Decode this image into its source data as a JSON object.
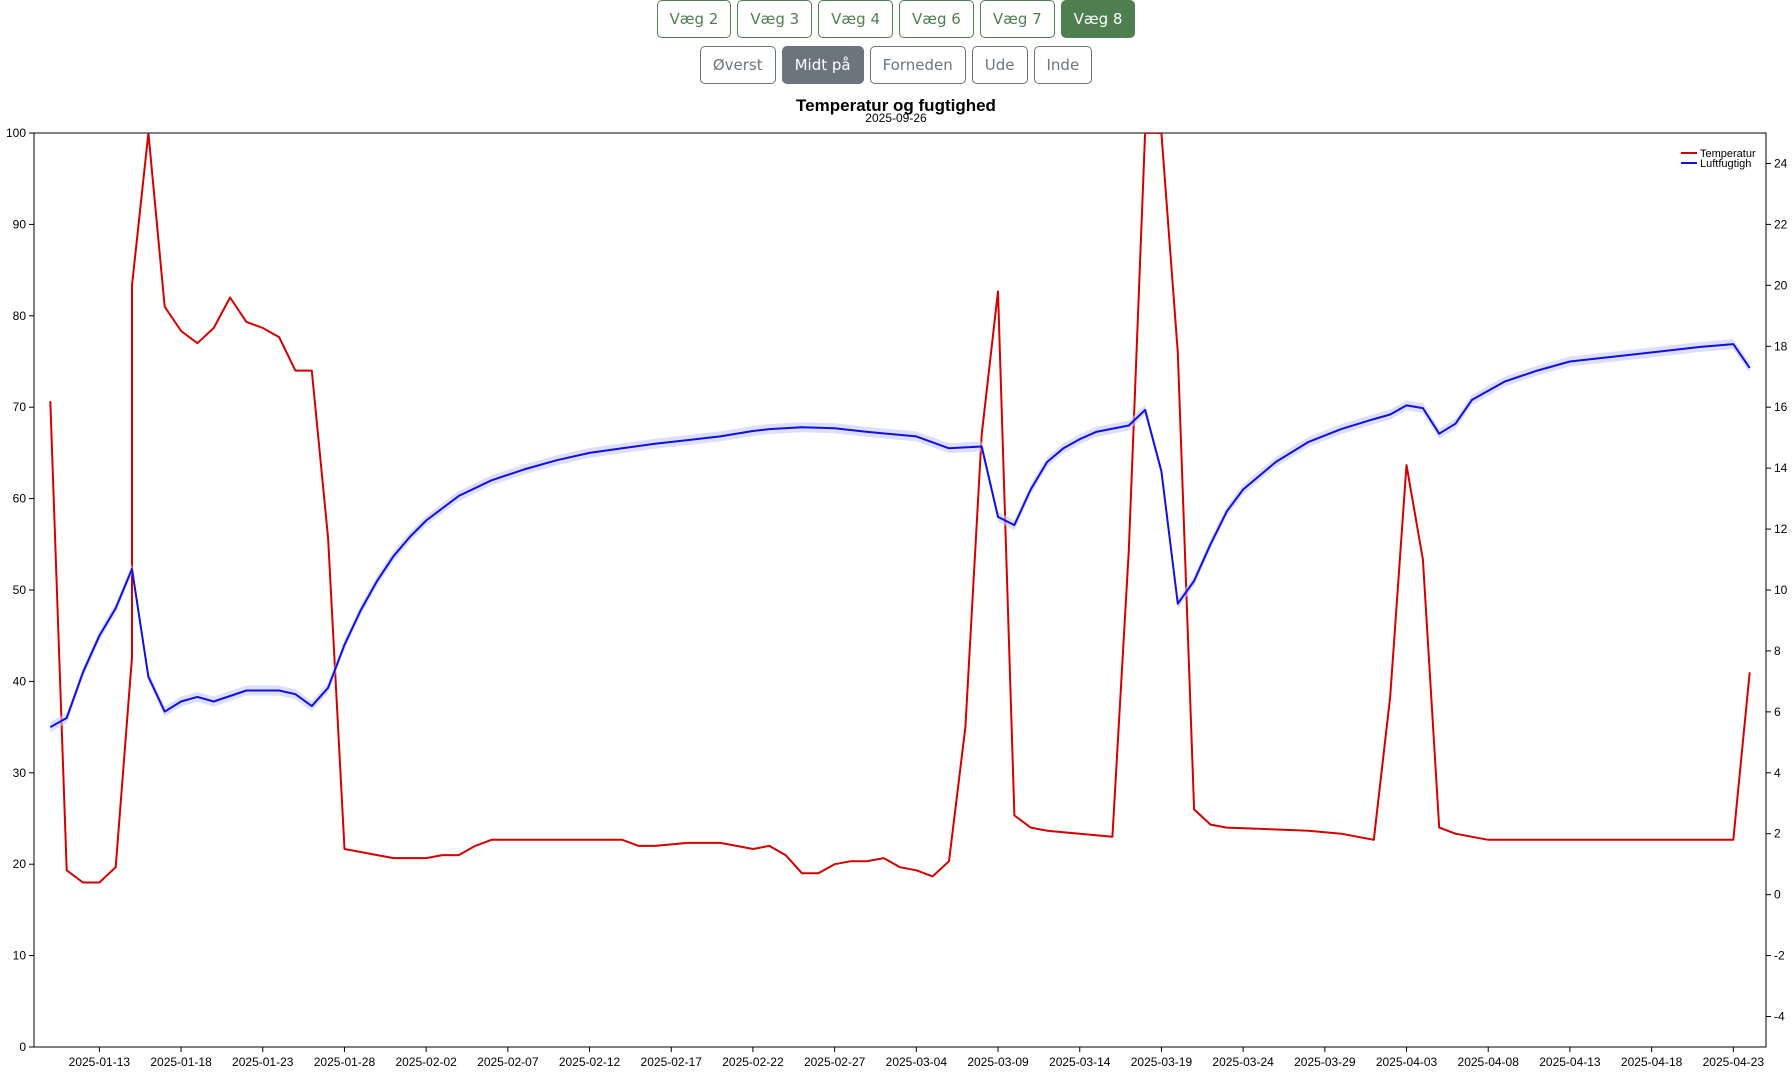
{
  "walls": {
    "buttons": [
      "Væg 2",
      "Væg 3",
      "Væg 4",
      "Væg 6",
      "Væg 7",
      "Væg 8"
    ],
    "active_index": 5,
    "color": "#4f7f50"
  },
  "positions": {
    "buttons": [
      "Øverst",
      "Midt på",
      "Forneden",
      "Ude",
      "Inde"
    ],
    "active_index": 1,
    "color": "#6c757d"
  },
  "chart_data": {
    "type": "line",
    "title": "Temperatur og fugtighed",
    "subtitle": "2025-09-26",
    "x_tick_labels": [
      "2025-01-13",
      "2025-01-18",
      "2025-01-23",
      "2025-01-28",
      "2025-02-02",
      "2025-02-07",
      "2025-02-12",
      "2025-02-17",
      "2025-02-22",
      "2025-02-27",
      "2025-03-04",
      "2025-03-09",
      "2025-03-14",
      "2025-03-19",
      "2025-03-24",
      "2025-03-29",
      "2025-04-03",
      "2025-04-08",
      "2025-04-13",
      "2025-04-18",
      "2025-04-23"
    ],
    "xlim": [
      "2025-01-09",
      "2025-04-25"
    ],
    "y_left": {
      "lim": [
        0,
        100
      ],
      "ticks": [
        0,
        10,
        20,
        30,
        40,
        50,
        60,
        70,
        80,
        90,
        100
      ]
    },
    "y_right": {
      "lim": [
        -5,
        25
      ],
      "ticks": [
        -4,
        -2,
        0,
        2,
        4,
        6,
        8,
        10,
        12,
        14,
        16,
        18,
        20,
        22,
        24
      ]
    },
    "legend_position": "top-right",
    "grid": false,
    "series": [
      {
        "name": "Temperatur",
        "axis": "right",
        "color": "#d40000",
        "x": [
          "2025-01-10",
          "2025-01-11",
          "2025-01-12",
          "2025-01-13",
          "2025-01-14",
          "2025-01-15",
          "2025-01-15",
          "2025-01-16",
          "2025-01-16",
          "2025-01-17",
          "2025-01-18",
          "2025-01-19",
          "2025-01-20",
          "2025-01-21",
          "2025-01-22",
          "2025-01-23",
          "2025-01-24",
          "2025-01-25",
          "2025-01-26",
          "2025-01-27",
          "2025-01-28",
          "2025-01-29",
          "2025-01-30",
          "2025-01-31",
          "2025-02-01",
          "2025-02-02",
          "2025-02-03",
          "2025-02-04",
          "2025-02-05",
          "2025-02-06",
          "2025-02-07",
          "2025-02-08",
          "2025-02-10",
          "2025-02-12",
          "2025-02-14",
          "2025-02-15",
          "2025-02-16",
          "2025-02-18",
          "2025-02-20",
          "2025-02-21",
          "2025-02-22",
          "2025-02-23",
          "2025-02-24",
          "2025-02-25",
          "2025-02-26",
          "2025-02-27",
          "2025-02-28",
          "2025-03-01",
          "2025-03-02",
          "2025-03-03",
          "2025-03-04",
          "2025-03-05",
          "2025-03-06",
          "2025-03-07",
          "2025-03-08",
          "2025-03-09",
          "2025-03-10",
          "2025-03-11",
          "2025-03-12",
          "2025-03-14",
          "2025-03-16",
          "2025-03-17",
          "2025-03-18",
          "2025-03-19",
          "2025-03-19",
          "2025-03-20",
          "2025-03-21",
          "2025-03-22",
          "2025-03-23",
          "2025-03-28",
          "2025-03-30",
          "2025-04-01",
          "2025-04-02",
          "2025-04-03",
          "2025-04-04",
          "2025-04-05",
          "2025-04-06",
          "2025-04-07",
          "2025-04-08",
          "2025-04-10",
          "2025-04-14",
          "2025-04-17",
          "2025-04-22",
          "2025-04-23",
          "2025-04-24"
        ],
        "y": [
          16.2,
          0.8,
          0.4,
          0.4,
          0.9,
          7.8,
          20.0,
          25.0,
          25.0,
          19.3,
          18.5,
          18.1,
          18.6,
          19.6,
          18.8,
          18.6,
          18.3,
          17.2,
          17.2,
          11.7,
          1.5,
          1.4,
          1.3,
          1.2,
          1.2,
          1.2,
          1.3,
          1.3,
          1.6,
          1.8,
          1.8,
          1.8,
          1.8,
          1.8,
          1.8,
          1.6,
          1.6,
          1.7,
          1.7,
          1.6,
          1.5,
          1.6,
          1.3,
          0.7,
          0.7,
          1.0,
          1.1,
          1.1,
          1.2,
          0.9,
          0.8,
          0.6,
          1.1,
          5.5,
          15.1,
          19.8,
          2.6,
          2.2,
          2.1,
          2.0,
          1.9,
          11.3,
          25.0,
          25.0,
          25.0,
          17.8,
          2.8,
          2.3,
          2.2,
          2.1,
          2.0,
          1.8,
          6.5,
          14.1,
          11.0,
          2.2,
          2.0,
          1.9,
          1.8,
          1.8,
          1.8,
          1.8,
          1.8,
          1.8,
          7.3
        ]
      },
      {
        "name": "Luftfugtigh",
        "axis": "left",
        "color": "#1010e0",
        "band_color": "#c8c8ff",
        "x": [
          "2025-01-10",
          "2025-01-11",
          "2025-01-12",
          "2025-01-13",
          "2025-01-14",
          "2025-01-15",
          "2025-01-16",
          "2025-01-17",
          "2025-01-18",
          "2025-01-19",
          "2025-01-20",
          "2025-01-21",
          "2025-01-22",
          "2025-01-24",
          "2025-01-25",
          "2025-01-26",
          "2025-01-27",
          "2025-01-28",
          "2025-01-29",
          "2025-01-30",
          "2025-01-31",
          "2025-02-01",
          "2025-02-02",
          "2025-02-04",
          "2025-02-06",
          "2025-02-08",
          "2025-02-10",
          "2025-02-12",
          "2025-02-14",
          "2025-02-16",
          "2025-02-18",
          "2025-02-20",
          "2025-02-22",
          "2025-02-23",
          "2025-02-25",
          "2025-02-27",
          "2025-03-01",
          "2025-03-04",
          "2025-03-06",
          "2025-03-08",
          "2025-03-09",
          "2025-03-10",
          "2025-03-11",
          "2025-03-12",
          "2025-03-13",
          "2025-03-14",
          "2025-03-15",
          "2025-03-17",
          "2025-03-18",
          "2025-03-19",
          "2025-03-20",
          "2025-03-21",
          "2025-03-22",
          "2025-03-23",
          "2025-03-24",
          "2025-03-26",
          "2025-03-28",
          "2025-03-30",
          "2025-04-01",
          "2025-04-02",
          "2025-04-03",
          "2025-04-04",
          "2025-04-05",
          "2025-04-06",
          "2025-04-07",
          "2025-04-09",
          "2025-04-11",
          "2025-04-13",
          "2025-04-17",
          "2025-04-21",
          "2025-04-23",
          "2025-04-24"
        ],
        "y": [
          35,
          36,
          41,
          45,
          48,
          52.3,
          40.5,
          36.7,
          37.8,
          38.3,
          37.8,
          38.4,
          39,
          39,
          38.6,
          37.3,
          39.3,
          44,
          47.8,
          51,
          53.7,
          55.8,
          57.6,
          60.3,
          62,
          63.2,
          64.2,
          65,
          65.5,
          66,
          66.4,
          66.8,
          67.4,
          67.6,
          67.8,
          67.7,
          67.3,
          66.8,
          65.5,
          65.7,
          58,
          57.1,
          61,
          64,
          65.5,
          66.5,
          67.3,
          68,
          69.7,
          63,
          48.5,
          51,
          55,
          58.6,
          61,
          64,
          66.2,
          67.6,
          68.7,
          69.2,
          70.2,
          69.9,
          67.1,
          68.2,
          70.8,
          72.8,
          74,
          75,
          75.8,
          76.6,
          76.9,
          74.3
        ]
      }
    ]
  }
}
